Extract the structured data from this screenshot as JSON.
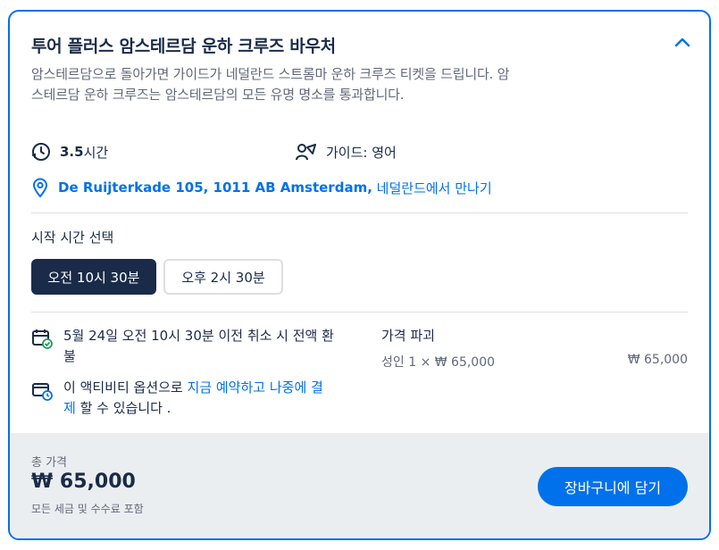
{
  "header": {
    "title": "투어 플러스 암스테르담 운하 크루즈 바우처"
  },
  "description": "암스테르담으로 돌아가면 가이드가 네덜란드 스트롬마 운하 크루즈 티켓을 드립니다. 암스테르담 운하 크루즈는 암스테르담의 모든 유명 명소를 통과합니다.",
  "meta": {
    "duration_value": "3.5",
    "duration_unit": "시간",
    "guide": "가이드: 영어"
  },
  "location": {
    "address": "De Ruijterkade 105, 1011 AB Amsterdam,",
    "meet_text": " 네덜란드에서 만나기"
  },
  "start_time": {
    "label": "시작 시간 선택",
    "options": [
      "오전 10시 30분",
      "오후 2시 30분"
    ],
    "selected": "오전 10시 30분"
  },
  "policies": {
    "cancellation": "5월 24일 오전 10시 30분 이전 취소 시 전액 환불",
    "reserve_prefix": "이 액티비티 옵션으로 ",
    "reserve_link": "지금 예약하고 나중에 결제",
    "reserve_suffix": " 할 수 있습니다 ."
  },
  "price_breakdown": {
    "label": "가격 파괴",
    "line_desc": "성인 1 × ₩ 65,000",
    "line_total": "₩ 65,000"
  },
  "footer": {
    "total_label": "총 가격",
    "total_value": "₩ 65,000",
    "total_note": "모든 세금 및 수수료 포함",
    "cart_button": "장바구니에 담기"
  },
  "colors": {
    "accent": "#0071eb",
    "dark": "#1a2b49",
    "muted": "#63687a",
    "footer_bg": "#ebeef1"
  },
  "icons": [
    "chevron-up-icon",
    "clock-icon",
    "guide-icon",
    "map-pin-icon",
    "calendar-check-icon",
    "card-clock-icon"
  ]
}
